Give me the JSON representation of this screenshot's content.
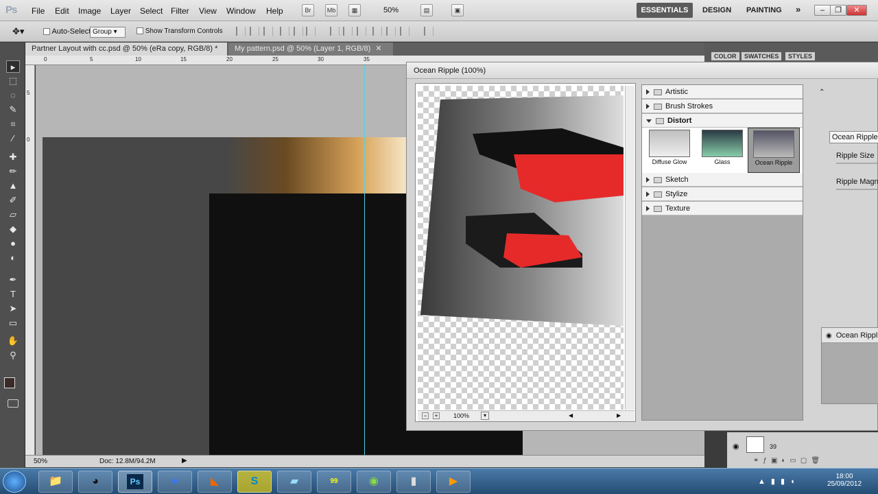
{
  "app": {
    "logo": "Ps"
  },
  "menu": {
    "items": [
      "File",
      "Edit",
      "Image",
      "Layer",
      "Select",
      "Filter",
      "View",
      "Window",
      "Help"
    ]
  },
  "menubar": {
    "br": "Br",
    "mb": "Mb",
    "zoom": "50%"
  },
  "workspaces": {
    "active": "ESSENTIALS",
    "items": [
      "DESIGN",
      "PAINTING"
    ],
    "more": "»"
  },
  "window_controls": {
    "minimize": "–",
    "restore": "❐",
    "close": "✕"
  },
  "options": {
    "auto_select_label": "Auto-Select:",
    "auto_select_value": "Group",
    "transform_label": "Show Transform Controls"
  },
  "tabs": [
    {
      "label": "Partner Layout with cc.psd @ 50% (eRa copy, RGB/8) *",
      "close": "✕"
    },
    {
      "label": "My pattern.psd @ 50% (Layer 1, RGB/8)",
      "close": "✕"
    }
  ],
  "ruler": {
    "h": [
      "0",
      "5",
      "10",
      "15",
      "20",
      "25",
      "30",
      "35"
    ],
    "v": [
      "0",
      "5"
    ]
  },
  "status": {
    "zoom": "50%",
    "doc": "Doc: 12.8M/94.2M"
  },
  "right_panel": {
    "tabs": [
      "COLOR",
      "SWATCHES",
      "STYLES"
    ],
    "layer_number": "39"
  },
  "dialog": {
    "title": "Ocean Ripple (100%)",
    "zoom": "100%",
    "categories": [
      {
        "label": "Artistic",
        "open": false
      },
      {
        "label": "Brush Strokes",
        "open": false
      },
      {
        "label": "Distort",
        "open": true
      },
      {
        "label": "Sketch",
        "open": false
      },
      {
        "label": "Stylize",
        "open": false
      },
      {
        "label": "Texture",
        "open": false
      }
    ],
    "thumbs": [
      {
        "label": "Diffuse Glow"
      },
      {
        "label": "Glass"
      },
      {
        "label": "Ocean Ripple"
      }
    ],
    "filter_select": "Ocean Ripple",
    "ripple_size_label": "Ripple Size",
    "ripple_mag_label": "Ripple Magnit",
    "effect_layer": "Ocean Rippl"
  },
  "taskbar": {
    "time": "18:00",
    "date": "25/09/2012",
    "ps_label": "Ps",
    "badge": "99"
  }
}
